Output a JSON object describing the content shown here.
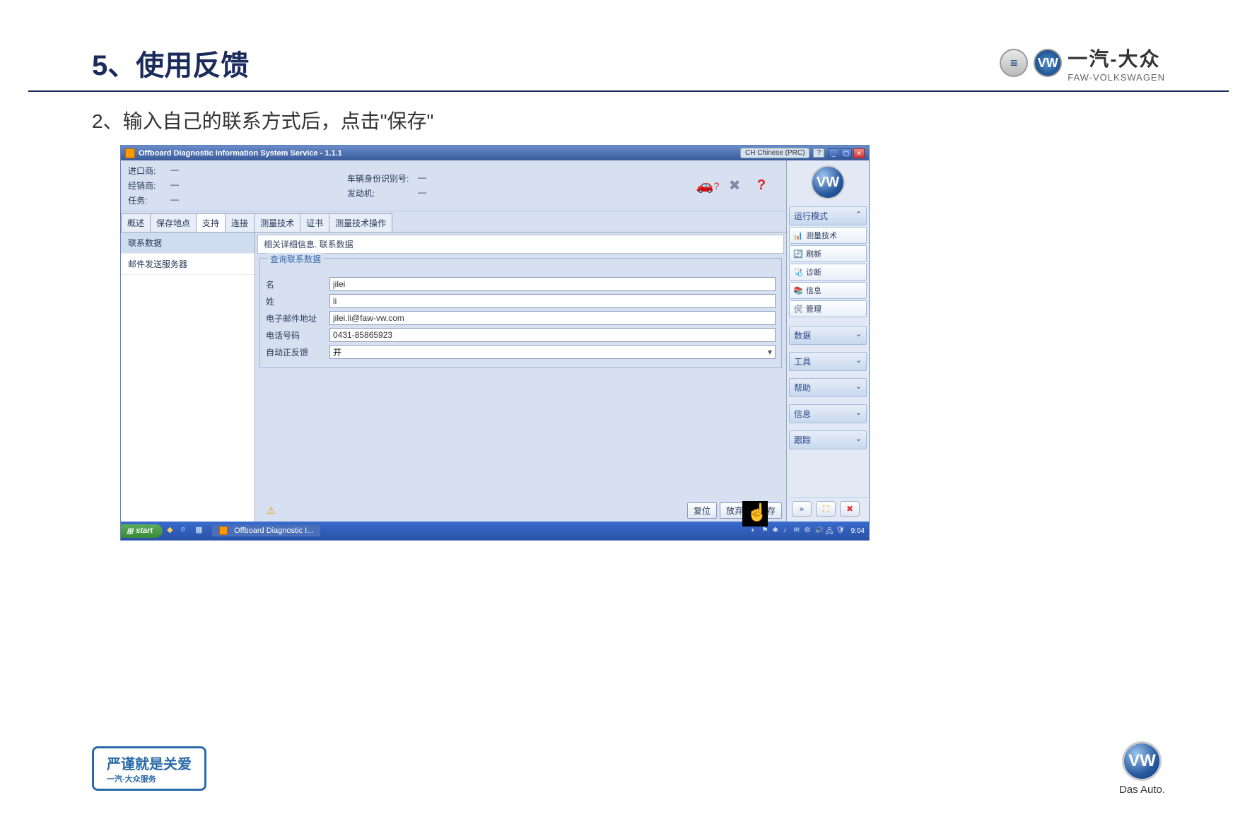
{
  "header": {
    "title": "5、使用反馈",
    "brand_cn": "一汽-大众",
    "brand_en": "FAW-VOLKSWAGEN"
  },
  "subtitle": "2、输入自己的联系方式后，点击\"保存\"",
  "app": {
    "titlebar": "Offboard Diagnostic Information System Service - 1.1.1",
    "language": "CH Chinese (PRC)",
    "help": "?",
    "info": {
      "importer_lbl": "进口商:",
      "importer_val": "—",
      "dealer_lbl": "经销商:",
      "dealer_val": "—",
      "task_lbl": "任务:",
      "task_val": "—",
      "vin_lbl": "车辆身份识别号:",
      "vin_val": "—",
      "engine_lbl": "发动机:",
      "engine_val": "—"
    },
    "tabs": [
      "概述",
      "保存地点",
      "支持",
      "连接",
      "测量技术",
      "证书",
      "测量技术操作"
    ],
    "active_tab_index": 2,
    "sidelist": {
      "items": [
        "联系数据",
        "邮件发送服务器"
      ],
      "selected_index": 0
    },
    "form": {
      "title": "相关详细信息. 联系数据",
      "legend": "查询联系数据",
      "name_lbl": "名",
      "name_val": "jilei",
      "surname_lbl": "姓",
      "surname_val": "li",
      "email_lbl": "电子邮件地址",
      "email_val": "jilei.li@faw-vw.com",
      "phone_lbl": "电话号码",
      "phone_val": "0431-85865923",
      "feedback_lbl": "自动正反馈",
      "feedback_val": "开"
    },
    "buttons": {
      "reset": "复位",
      "discard": "放弃",
      "save": "保存"
    },
    "rightpanel": {
      "vw_mark": "VW",
      "mode_header": "运行模式",
      "mode_items": [
        {
          "icon": "📊",
          "label": "测量技术"
        },
        {
          "icon": "🔄",
          "label": "刷新"
        },
        {
          "icon": "🩺",
          "label": "诊断"
        },
        {
          "icon": "📚",
          "label": "信息"
        },
        {
          "icon": "🛠",
          "label": "管理"
        }
      ],
      "sections": [
        "数据",
        "工具",
        "帮助",
        "信息",
        "跟踪"
      ],
      "toolbar": {
        "next": "»",
        "expand": "⛶",
        "close": "✖"
      }
    }
  },
  "taskbar": {
    "start": "start",
    "task_item": "Offboard Diagnostic I...",
    "clock": "9:04"
  },
  "footer": {
    "badge_main": "严谨就是关爱",
    "badge_sub": "一汽-大众服务",
    "das_auto": "Das Auto."
  }
}
